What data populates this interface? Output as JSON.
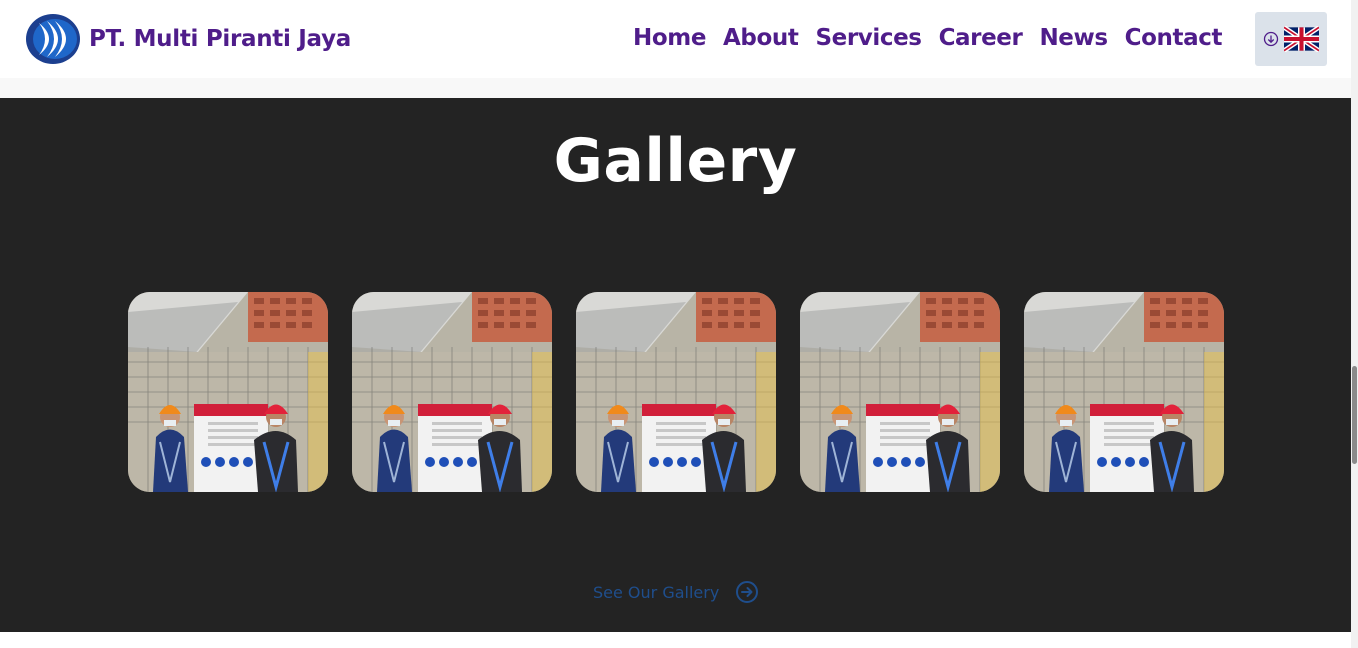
{
  "header": {
    "brand_name": "PT. Multi Piranti Jaya",
    "nav": [
      "Home",
      "About",
      "Services",
      "Career",
      "News",
      "Contact"
    ]
  },
  "gallery": {
    "title": "Gallery",
    "thumbnails_count": 5,
    "see_link": "See Our Gallery"
  },
  "colors": {
    "brand_purple": "#4f1d8a",
    "section_bg": "#232323",
    "link_blue": "#1f4e8c"
  },
  "icons": {
    "logo": "company-logo",
    "lang_arrow": "arrow-down-circle-icon",
    "flag": "uk-flag-icon",
    "see_arrow": "arrow-right-circle-icon"
  }
}
